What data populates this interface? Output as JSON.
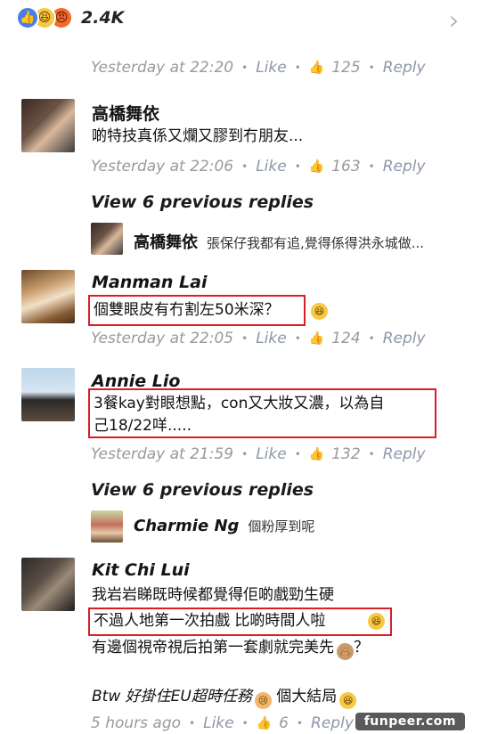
{
  "reactions": {
    "count": "2.4K",
    "icons": [
      "like-icon",
      "haha-icon",
      "angry-icon"
    ]
  },
  "first_meta": {
    "time": "Yesterday at 22:20",
    "like": "Like",
    "likes": "125",
    "reply": "Reply"
  },
  "comments": [
    {
      "name": "高橋舞依",
      "text": "啲特技真係又爛又膠到冇朋友...",
      "time": "Yesterday at 22:06",
      "like": "Like",
      "likes": "163",
      "reply": "Reply",
      "view_prev": "View 6 previous replies",
      "reply_preview": {
        "name": "高橋舞依",
        "text": "張保仔我都有追,覺得係得洪永城做..."
      }
    },
    {
      "name": "Manman Lai",
      "text": "個雙眼皮有冇割左50米深？",
      "time": "Yesterday at 22:05",
      "like": "Like",
      "likes": "124",
      "reply": "Reply"
    },
    {
      "name": "Annie Lio",
      "text_line1": "3餐kay對眼想點，con又大妝又濃，以為自",
      "text_line2": "己18/22咩.....",
      "time": "Yesterday at 21:59",
      "like": "Like",
      "likes": "132",
      "reply": "Reply",
      "view_prev": "View 6 previous replies",
      "reply_preview": {
        "name": "Charmie Ng",
        "text": "個粉厚到呢"
      }
    },
    {
      "name": "Kit Chi  Lui",
      "line1": "我岩岩睇既時候都覺得佢啲戲勁生硬",
      "line2": "不過人地第一次拍戲 比啲時間人啦",
      "line3": "有邊個視帝視后拍第一套劇就完美先",
      "line3_end": "？",
      "line4a": "Btw 好掛住EU超時任務",
      "line4b": "個大結局",
      "time": "5 hours ago",
      "like": "Like",
      "likes": "6",
      "reply": "Reply"
    }
  ],
  "watermark": "funpeer.com"
}
